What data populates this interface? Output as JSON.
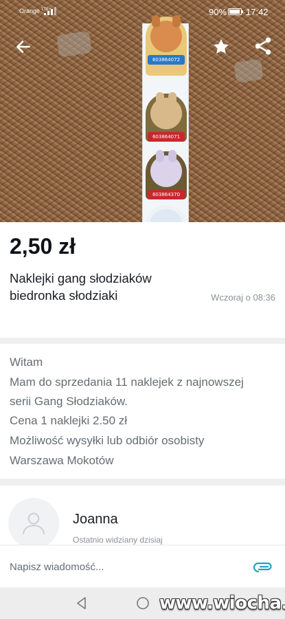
{
  "status_bar": {
    "carrier": "Orange",
    "network": "LTE+",
    "battery": "90%",
    "time": "17:42"
  },
  "toolbar": {
    "back_icon": "arrow-left-icon",
    "favorite_icon": "star-icon",
    "share_icon": "share-icon"
  },
  "photo": {
    "sticker_codes": [
      "603864072",
      "603864071",
      "603864370",
      ""
    ]
  },
  "listing": {
    "price": "2,50 zł",
    "title_line1": "Naklejki gang słodziaków",
    "title_line2": "biedronka słodziaki",
    "posted": "Wczoraj o 08:36"
  },
  "description": {
    "lines": [
      "Witam",
      "Mam do sprzedania 11 naklejek z najnowszej",
      "serii Gang Słodziaków.",
      "Cena 1 naklejki 2.50 zł",
      "Możliwość wysyłki lub odbiór osobisty",
      "Warszawa Mokotów"
    ]
  },
  "seller": {
    "name": "Joanna",
    "last_seen": "Ostatnio widziany dzisiaj"
  },
  "message": {
    "placeholder": "Napisz wiadomość..."
  },
  "watermark": "www.wiocha.pl",
  "colors": {
    "accent": "#1ea3c6",
    "text_primary": "#0f1216",
    "text_secondary": "#666c72"
  }
}
